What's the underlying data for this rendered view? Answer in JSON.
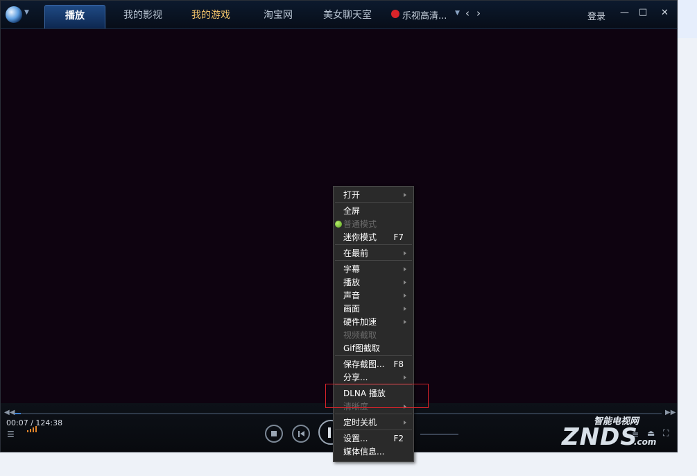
{
  "titlebar": {
    "tabs": [
      "播放",
      "我的影视",
      "我的游戏",
      "淘宝网",
      "美女聊天室"
    ],
    "active_tab": "播放",
    "channel": "乐视高清...",
    "login": "登录",
    "minimize": "—",
    "maximize": "□",
    "close": "✕"
  },
  "player": {
    "time_current": "00:07",
    "time_total": "/ 124:38",
    "progress_fraction": 0.01
  },
  "menu": {
    "items": [
      {
        "label": "打开",
        "shortcut": "",
        "submenu": true,
        "disabled": false
      },
      {
        "label": "全屏",
        "shortcut": "",
        "submenu": false,
        "disabled": false
      },
      {
        "label": "普通模式",
        "shortcut": "",
        "submenu": false,
        "disabled": true,
        "checked": true
      },
      {
        "label": "迷你模式",
        "shortcut": "F7",
        "submenu": false,
        "disabled": false
      },
      {
        "label": "在最前",
        "shortcut": "",
        "submenu": true,
        "disabled": false
      },
      {
        "label": "字幕",
        "shortcut": "",
        "submenu": true,
        "disabled": false
      },
      {
        "label": "播放",
        "shortcut": "",
        "submenu": true,
        "disabled": false
      },
      {
        "label": "声音",
        "shortcut": "",
        "submenu": true,
        "disabled": false
      },
      {
        "label": "画面",
        "shortcut": "",
        "submenu": true,
        "disabled": false
      },
      {
        "label": "硬件加速",
        "shortcut": "",
        "submenu": true,
        "disabled": false
      },
      {
        "label": "视频截取",
        "shortcut": "",
        "submenu": false,
        "disabled": true
      },
      {
        "label": "Gif图截取",
        "shortcut": "",
        "submenu": false,
        "disabled": false
      },
      {
        "label": "保存截图...",
        "shortcut": "F8",
        "submenu": false,
        "disabled": false
      },
      {
        "label": "分享...",
        "shortcut": "",
        "submenu": true,
        "disabled": false
      },
      {
        "label": "DLNA 播放",
        "shortcut": "",
        "submenu": false,
        "disabled": false
      },
      {
        "label": "清晰度",
        "shortcut": "",
        "submenu": true,
        "disabled": true
      },
      {
        "label": "定时关机",
        "shortcut": "",
        "submenu": true,
        "disabled": false
      },
      {
        "label": "设置...",
        "shortcut": "F2",
        "submenu": false,
        "disabled": false
      },
      {
        "label": "媒体信息...",
        "shortcut": "",
        "submenu": false,
        "disabled": false
      }
    ]
  },
  "watermark": {
    "top": "智能电视网",
    "main": "ZNDS",
    "suffix": ".com"
  },
  "colors": {
    "menu_bg": "#2a2a2a",
    "highlight_box": "#d8232a",
    "active_tab": "#1f4a84",
    "game_tab": "#f1c36a"
  }
}
